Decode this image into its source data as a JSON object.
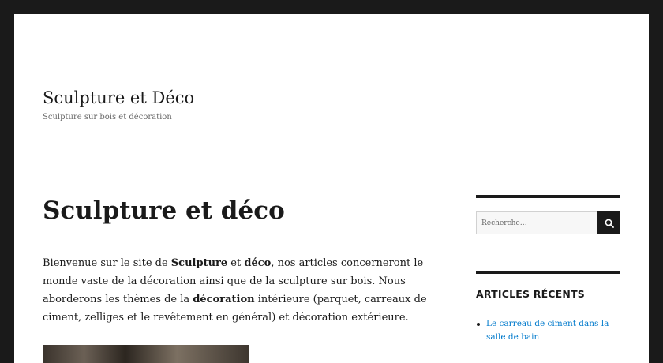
{
  "site": {
    "title": "Sculpture et Déco",
    "description": "Sculpture sur bois et décoration"
  },
  "article": {
    "title": "Sculpture et déco",
    "paragraph": [
      {
        "text": "Bienvenue sur le site de ",
        "bold": false
      },
      {
        "text": "Sculpture",
        "bold": true
      },
      {
        "text": " et ",
        "bold": false
      },
      {
        "text": "déco",
        "bold": true
      },
      {
        "text": ", nos articles concerneront le monde vaste de la décoration ainsi que de la sculpture sur bois. Nous aborderons les thèmes de la ",
        "bold": false
      },
      {
        "text": "décoration",
        "bold": true
      },
      {
        "text": " intérieure (parquet, carreaux de ciment, zelliges et le revêtement en général) et décoration extérieure.",
        "bold": false
      }
    ]
  },
  "sidebar": {
    "search": {
      "placeholder": "Recherche…",
      "icon": "search-icon"
    },
    "recent_posts": {
      "title": "ARTICLES RÉCENTS",
      "items": [
        {
          "label": "Le carreau de ciment dans la salle de bain"
        }
      ]
    }
  },
  "colors": {
    "frame": "#1a1a1a",
    "background": "#ffffff",
    "link": "#007acc",
    "text": "#1a1a1a",
    "muted": "#686868"
  }
}
